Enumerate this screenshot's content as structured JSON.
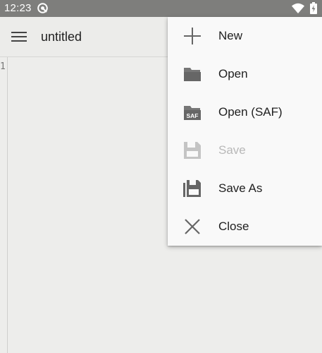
{
  "status_bar": {
    "time": "12:23",
    "icons": [
      "sync-icon",
      "wifi-icon",
      "battery-charging-icon"
    ]
  },
  "app_bar": {
    "menu_icon": "hamburger-icon",
    "title": "untitled"
  },
  "editor": {
    "line_numbers": [
      "1"
    ],
    "content": ""
  },
  "overflow_menu": {
    "items": [
      {
        "label": "New",
        "icon": "plus-icon",
        "enabled": true
      },
      {
        "label": "Open",
        "icon": "folder-icon",
        "enabled": true
      },
      {
        "label": "Open (SAF)",
        "icon": "folder-saf-icon",
        "icon_text": "SAF",
        "enabled": true
      },
      {
        "label": "Save",
        "icon": "save-icon",
        "enabled": false
      },
      {
        "label": "Save As",
        "icon": "save-as-icon",
        "enabled": true
      },
      {
        "label": "Close",
        "icon": "close-icon",
        "enabled": true
      }
    ]
  },
  "colors": {
    "status_bar": "#7e7e7c",
    "background": "#ededeb",
    "menu_background": "#f9f9f9",
    "icon": "#666666",
    "icon_disabled": "#c4c4c4",
    "text_disabled": "#b8b8b8"
  }
}
